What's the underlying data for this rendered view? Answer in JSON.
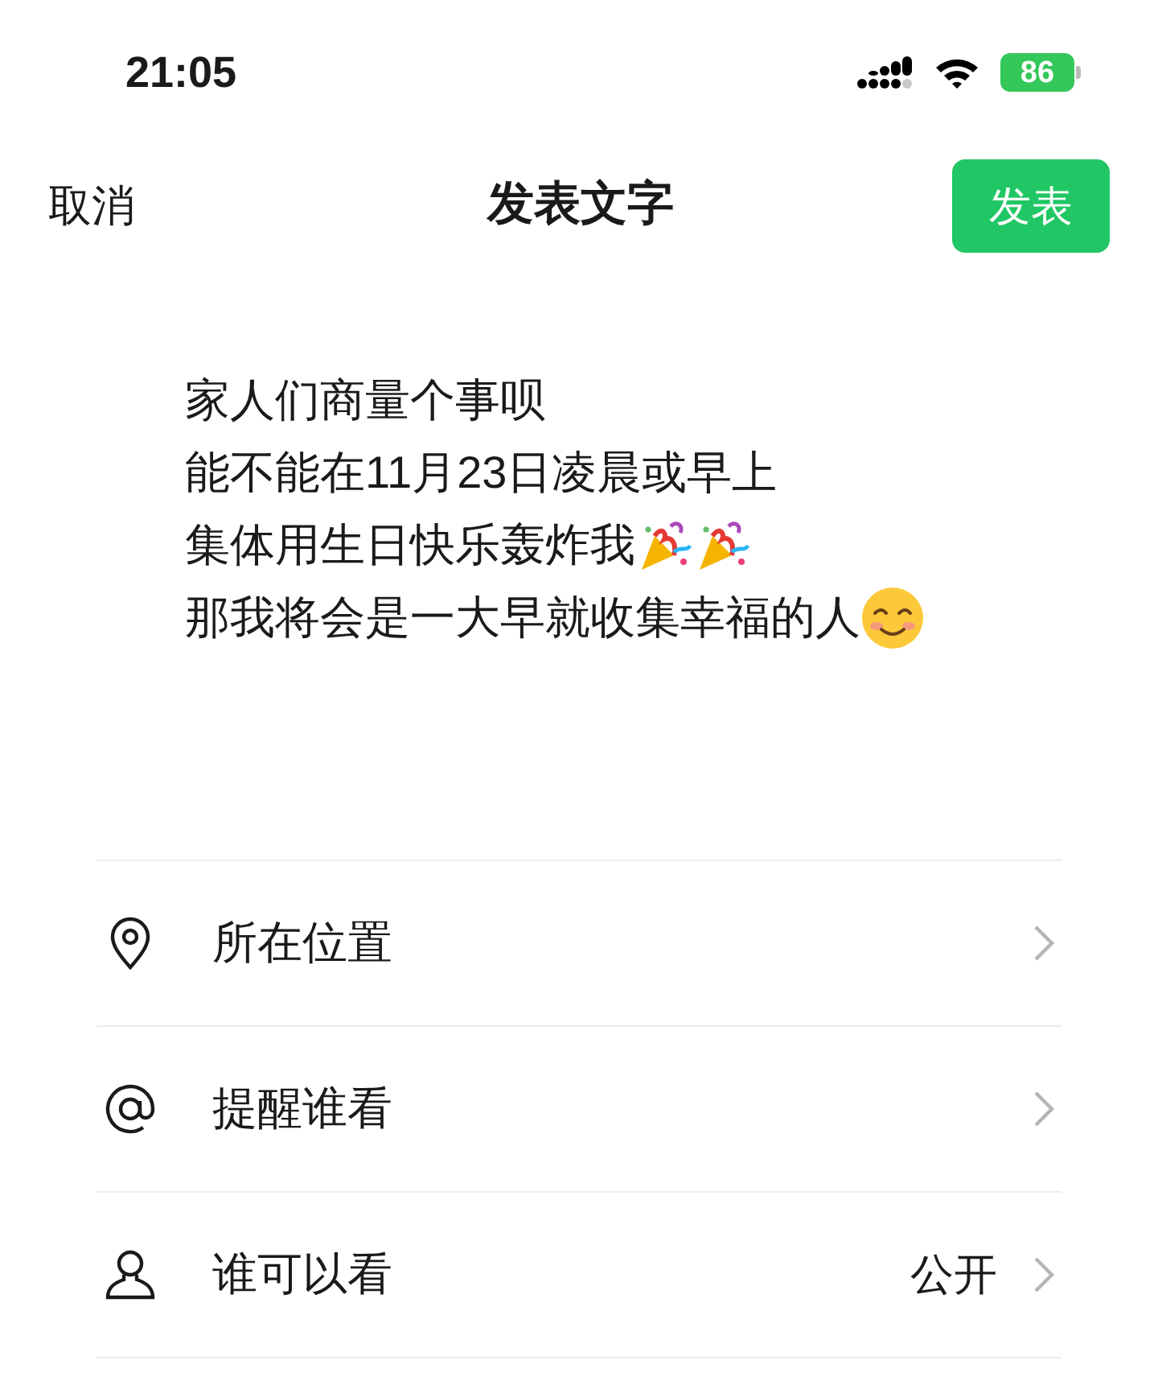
{
  "status_bar": {
    "time": "21:05",
    "battery": "86"
  },
  "nav": {
    "cancel": "取消",
    "title": "发表文字",
    "publish": "发表"
  },
  "post_lines": [
    {
      "text": "家人们商量个事呗"
    },
    {
      "text": "能不能在11月23日凌晨或早上"
    },
    {
      "text": "集体用生日快乐轰炸我",
      "icons": [
        {
          "kind": "party"
        },
        {
          "kind": "party"
        }
      ]
    },
    {
      "text": "那我将会是一大早就收集幸福的人",
      "icons": [
        {
          "kind": "smile"
        }
      ]
    }
  ],
  "options": [
    {
      "kind": "location",
      "label": "所在位置"
    },
    {
      "kind": "mention",
      "label": "提醒谁看"
    },
    {
      "kind": "visibility",
      "label": "谁可以看",
      "value": "公开"
    }
  ]
}
